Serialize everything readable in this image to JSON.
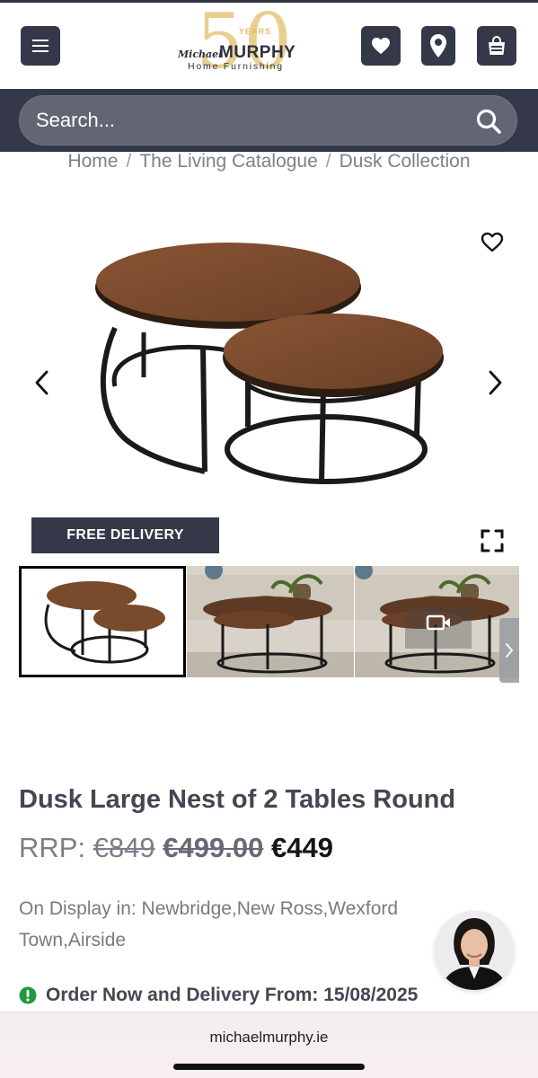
{
  "header": {
    "menu_icon": "hamburger-menu-icon",
    "logo": {
      "fifty": "50",
      "years": "YEARS",
      "michael": "Michael",
      "murphy": "MURPHY",
      "home": "Home Furnishing"
    },
    "icons": [
      "heart-icon",
      "location-pin-icon",
      "shopping-bag-icon"
    ]
  },
  "search": {
    "placeholder": "Search..."
  },
  "breadcrumb": {
    "items": [
      "Home",
      "The Living Catalogue",
      "Dusk Collection"
    ],
    "separator": "/"
  },
  "gallery": {
    "badge": "FREE DELIVERY",
    "thumbnail_count": 3
  },
  "product": {
    "title": "Dusk Large Nest of 2 Tables Round",
    "price_rrp_label": "RRP:",
    "price_rrp": "€849",
    "price_was": "€499.00",
    "price_now": "€449",
    "display_text": "On Display in: Newbridge,New Ross,Wexford Town,Airside",
    "delivery_text": "Order Now and Delivery From: 15/08/2025"
  },
  "browser": {
    "url": "michaelmurphy.ie"
  },
  "colors": {
    "brand_dark": "#343848",
    "search_bg": "#626674",
    "gold": "#e2c06a",
    "alert_green": "#1f9a3f"
  }
}
